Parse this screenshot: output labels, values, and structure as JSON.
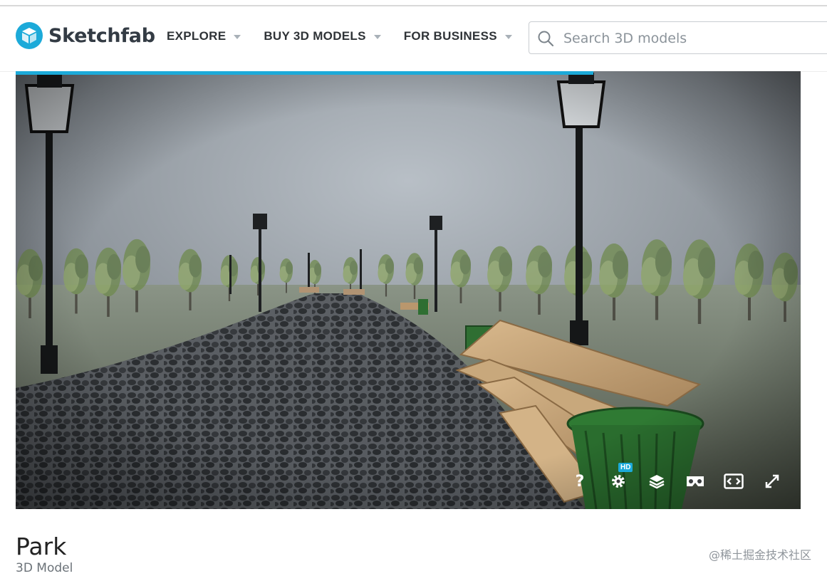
{
  "brand": {
    "name": "Sketchfab",
    "accent": "#1caad9"
  },
  "nav": {
    "items": [
      {
        "label": "EXPLORE",
        "icon": "chevron-down-icon"
      },
      {
        "label": "BUY 3D MODELS",
        "icon": "chevron-down-icon"
      },
      {
        "label": "FOR BUSINESS",
        "icon": "chevron-down-icon"
      }
    ]
  },
  "search": {
    "placeholder": "Search 3D models",
    "value": "",
    "icon": "search-icon"
  },
  "viewer": {
    "loading_progress": 0.736,
    "controls": [
      {
        "name": "help-button",
        "label": "?"
      },
      {
        "name": "settings-button",
        "badge": "HD"
      },
      {
        "name": "layers-button"
      },
      {
        "name": "vr-button"
      },
      {
        "name": "embed-button"
      },
      {
        "name": "fullscreen-button"
      }
    ]
  },
  "model": {
    "title": "Park",
    "type": "3D Model"
  },
  "watermark": "@稀土掘金技术社区"
}
